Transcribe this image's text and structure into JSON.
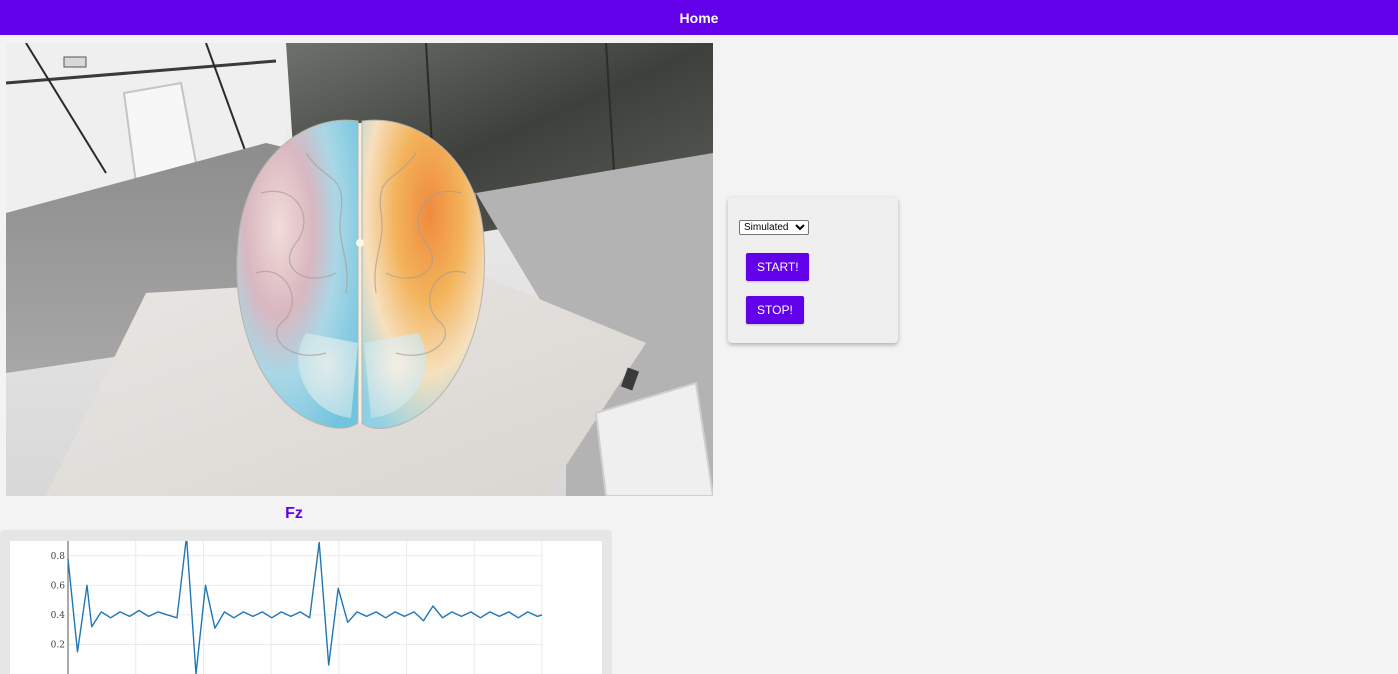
{
  "header": {
    "home_label": "Home",
    "color": "#6200ea"
  },
  "viewer": {
    "subject": "3D brain model with colored activity overlay, displayed in an AR scene of an office desk",
    "icon": "brain-model"
  },
  "controls": {
    "source_select": {
      "selected": "Simulated",
      "options": [
        "Simulated"
      ]
    },
    "start_label": "START!",
    "stop_label": "STOP!"
  },
  "channel": {
    "title": "Fz"
  },
  "chart_data": {
    "type": "line",
    "title": "Fz",
    "xlabel": "",
    "ylabel": "",
    "ylim": [
      0.0,
      0.9
    ],
    "yticks": [
      0.2,
      0.4,
      0.6,
      0.8
    ],
    "grid": true,
    "series": [
      {
        "color": "#1f77b4",
        "x": [
          0,
          2,
          4,
          5,
          7,
          9,
          11,
          13,
          15,
          17,
          19,
          21,
          23,
          25,
          27,
          29,
          31,
          33,
          35,
          37,
          39,
          41,
          43,
          45,
          47,
          49,
          51,
          53,
          55,
          57,
          59,
          61,
          63,
          65,
          67,
          69,
          71,
          73,
          75,
          77,
          79,
          81,
          83,
          85,
          87,
          89,
          91,
          93,
          95,
          97,
          99,
          100
        ],
        "y": [
          0.78,
          0.15,
          0.6,
          0.32,
          0.42,
          0.38,
          0.42,
          0.39,
          0.43,
          0.39,
          0.42,
          0.4,
          0.38,
          0.93,
          0.0,
          0.6,
          0.31,
          0.42,
          0.38,
          0.42,
          0.39,
          0.42,
          0.38,
          0.42,
          0.39,
          0.42,
          0.38,
          0.89,
          0.06,
          0.58,
          0.35,
          0.42,
          0.39,
          0.42,
          0.38,
          0.42,
          0.39,
          0.42,
          0.36,
          0.46,
          0.38,
          0.42,
          0.39,
          0.42,
          0.38,
          0.42,
          0.39,
          0.42,
          0.38,
          0.42,
          0.39,
          0.4
        ]
      }
    ]
  }
}
